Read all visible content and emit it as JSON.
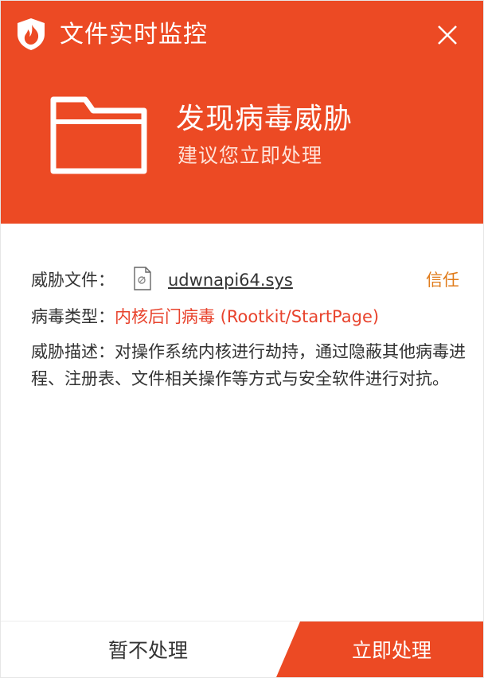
{
  "window": {
    "title": "文件实时监控",
    "close_icon": "close-icon",
    "app_icon": "shield-flame-icon"
  },
  "alert": {
    "icon": "folder-icon",
    "title": "发现病毒威胁",
    "subtitle": "建议您立即处理"
  },
  "details": {
    "file_label": "威胁文件：",
    "file_icon": "file-icon",
    "file_name": "udwnapi64.sys",
    "trust_label": "信任",
    "type_label": "病毒类型：",
    "type_value": "内核后门病毒 (Rootkit/StartPage)",
    "desc_label": "威胁描述：",
    "desc_value": "对操作系统内核进行劫持，通过隐蔽其他病毒进程、注册表、文件相关操作等方式与安全软件进行对抗。"
  },
  "actions": {
    "ignore_label": "暂不处理",
    "handle_label": "立即处理"
  },
  "colors": {
    "header_bg": "#ec4a24",
    "danger_text": "#e8432d",
    "trust_text": "#e07b1a"
  }
}
